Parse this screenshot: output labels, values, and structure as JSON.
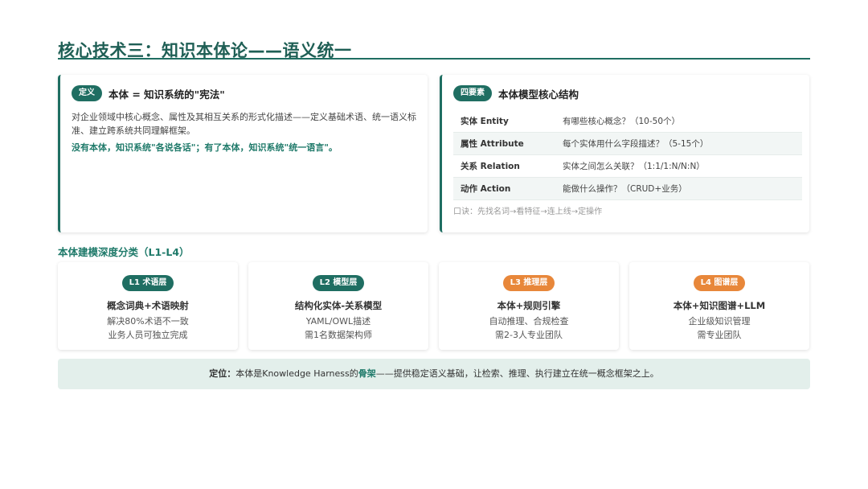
{
  "title": "核心技术三：知识本体论——语义统一",
  "definition": {
    "badge": "定义",
    "heading": "本体 = 知识系统的\"宪法\"",
    "body": "对企业领域中核心概念、属性及其相互关系的形式化描述——定义基础术语、统一语义标准、建立跨系统共同理解框架。",
    "emphasis": "没有本体，知识系统\"各说各话\"；有了本体，知识系统\"统一语言\"。"
  },
  "structure": {
    "badge": "四要素",
    "heading": "本体模型核心结构",
    "rows": [
      {
        "key": "实体 Entity",
        "value": "有哪些核心概念？（10-50个）"
      },
      {
        "key": "属性 Attribute",
        "value": "每个实体用什么字段描述？（5-15个）"
      },
      {
        "key": "关系 Relation",
        "value": "实体之间怎么关联？（1:1/1:N/N:N）"
      },
      {
        "key": "动作 Action",
        "value": "能做什么操作？（CRUD+业务）"
      }
    ],
    "mnemonic": "口诀：先找名词→看特征→连上线→定操作"
  },
  "levels_label": "本体建模深度分类（L1-L4）",
  "levels": [
    {
      "badge": "L1 术语层",
      "title": "概念词典+术语映射",
      "line1": "解决80%术语不一致",
      "line2": "业务人员可独立完成",
      "color": "green"
    },
    {
      "badge": "L2 模型层",
      "title": "结构化实体-关系模型",
      "line1": "YAML/OWL描述",
      "line2": "需1名数据架构师",
      "color": "green"
    },
    {
      "badge": "L3 推理层",
      "title": "本体+规则引擎",
      "line1": "自动推理、合规检查",
      "line2": "需2-3人专业团队",
      "color": "orange"
    },
    {
      "badge": "L4 图谱层",
      "title": "本体+知识图谱+LLM",
      "line1": "企业级知识管理",
      "line2": "需专业团队",
      "color": "orange"
    }
  ],
  "positioning": {
    "label": "定位：",
    "pre": "本体是Knowledge Harness的",
    "highlight": "骨架",
    "post": "——提供稳定语义基础，让检索、推理、执行建立在统一概念框架之上。"
  },
  "colors": {
    "primary": "#1f6e62",
    "accent_orange": "#e8873a",
    "bar_bg": "#e3efeb"
  }
}
